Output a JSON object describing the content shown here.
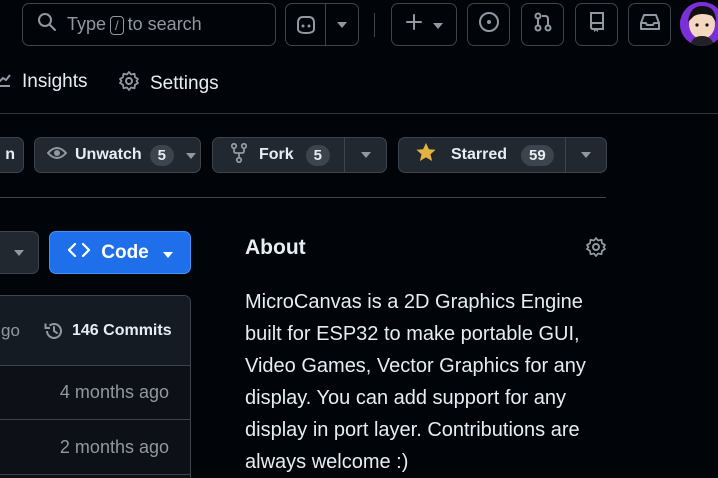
{
  "header": {
    "search_prefix": "Type",
    "search_key": "/",
    "search_suffix": "to search"
  },
  "nav": {
    "insights": "Insights",
    "settings": "Settings"
  },
  "actions": {
    "left_cut": "n",
    "unwatch_label": "Unwatch",
    "unwatch_count": "5",
    "fork_label": "Fork",
    "fork_count": "5",
    "starred_label": "Starred",
    "starred_count": "59",
    "star_color": "#e3b341"
  },
  "code": {
    "label": "Code"
  },
  "files": {
    "head_time_cut": "go",
    "commits_label": "146 Commits",
    "rows": [
      {
        "time": "4 months ago"
      },
      {
        "time": "2 months ago"
      }
    ]
  },
  "about": {
    "title": "About",
    "description": "MicroCanvas is a 2D Graphics Engine built for ESP32 to make portable GUI, Video Games, Vector Graphics for any display. You can add support for any display in port layer. Contributions are always welcome :)"
  }
}
